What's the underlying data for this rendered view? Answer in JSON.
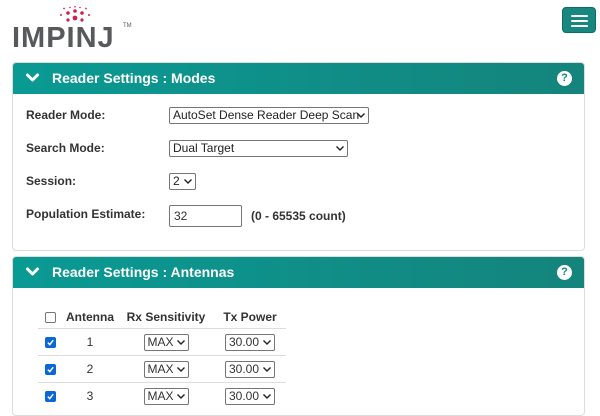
{
  "brand": {
    "name": "IMPINJ",
    "trademark": "TM",
    "accent": "#d1204e"
  },
  "header": {
    "menu_icon": "hamburger-icon",
    "bar_color": "#17877f"
  },
  "modes_panel": {
    "title": "Reader Settings : Modes",
    "help_icon": "?",
    "reader_mode": {
      "label": "Reader Mode:",
      "value": "AutoSet Dense Reader Deep Scan"
    },
    "search_mode": {
      "label": "Search Mode:",
      "value": "Dual Target"
    },
    "session": {
      "label": "Session:",
      "value": "2"
    },
    "population": {
      "label": "Population Estimate:",
      "value": "32",
      "hint": "(0 - 65535 count)"
    }
  },
  "antennas_panel": {
    "title": "Reader Settings : Antennas",
    "help_icon": "?",
    "columns": [
      "Antenna",
      "Rx Sensitivity",
      "Tx Power"
    ],
    "header_checked": false,
    "rows": [
      {
        "checked": true,
        "antenna": "1",
        "rx": "MAX",
        "tx": "30.00"
      },
      {
        "checked": true,
        "antenna": "2",
        "rx": "MAX",
        "tx": "30.00"
      },
      {
        "checked": true,
        "antenna": "3",
        "rx": "MAX",
        "tx": "30.00"
      }
    ]
  }
}
